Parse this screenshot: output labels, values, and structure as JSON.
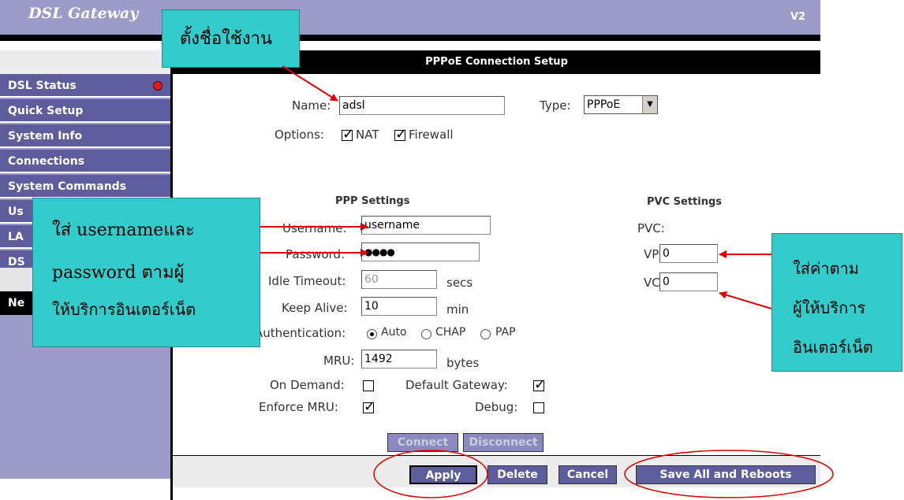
{
  "header": {
    "title": "DSL Gateway",
    "version": "V2"
  },
  "sidebar": {
    "items": [
      {
        "label": "DSL Status"
      },
      {
        "label": "Quick Setup"
      },
      {
        "label": "System Info"
      },
      {
        "label": "Connections"
      },
      {
        "label": "System Commands"
      },
      {
        "label": "Us"
      },
      {
        "label": "LA"
      },
      {
        "label": "DS"
      }
    ],
    "active_label": "Ne"
  },
  "main": {
    "title": "PPPoE Connection Setup",
    "name_label": "Name:",
    "name_value": "adsl",
    "type_label": "Type:",
    "type_value": "PPPoE",
    "options_label": "Options:",
    "nat_label": "NAT",
    "firewall_label": "Firewall",
    "ppp_heading": "PPP Settings",
    "pvc_heading": "PVC Settings",
    "username_label": "Username:",
    "username_value": "username",
    "password_label": "Password:",
    "password_value": "●●●●",
    "idle_label": "Idle Timeout:",
    "idle_value": "60",
    "idle_unit": "secs",
    "keepalive_label": "Keep Alive:",
    "keepalive_value": "10",
    "keepalive_unit": "min",
    "auth_label": "Authentication:",
    "auth_auto": "Auto",
    "auth_chap": "CHAP",
    "auth_pap": "PAP",
    "mru_label": "MRU:",
    "mru_value": "1492",
    "mru_unit": "bytes",
    "ondemand_label": "On Demand:",
    "defgw_label": "Default Gateway:",
    "enforce_label": "Enforce MRU:",
    "debug_label": "Debug:",
    "pvc_label": "PVC:",
    "vpi_label": "VPI:",
    "vpi_value": "0",
    "vci_label": "VCI:",
    "vci_value": "0"
  },
  "buttons": {
    "connect": "Connect",
    "disconnect": "Disconnect",
    "apply": "Apply",
    "delete": "Delete",
    "cancel": "Cancel",
    "save_reboot": "Save All and Reboots"
  },
  "annotations": {
    "name_callout": "ตั้งชื่อใช้งาน",
    "user_callout_1": "ใส่ usernameและ",
    "user_callout_2": "password ตามผู้",
    "user_callout_3": "ให้บริการอินเตอร์เน็ต",
    "pvc_callout_1": "ใส่ค่าตาม",
    "pvc_callout_2": "ผู้ให้บริการ",
    "pvc_callout_3": "อินเตอร์เน็ต"
  },
  "colors": {
    "header_bg": "#9b9ac8",
    "nav_bg": "#5d5c9c",
    "callout_bg": "#33cccc",
    "arrow_red": "#e00000"
  }
}
